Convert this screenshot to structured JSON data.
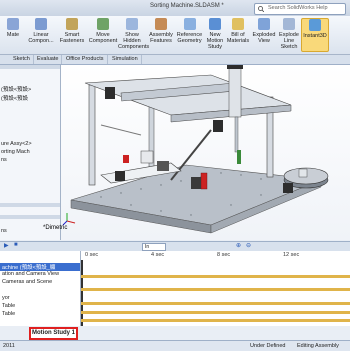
{
  "title_bar": {
    "title": "Sorting Machine.SLDASM *",
    "search_placeholder": "Search SolidWorks Help"
  },
  "ribbon": [
    {
      "label": "Mate",
      "icon": "mate-icon"
    },
    {
      "label": "Linear\nCompon...",
      "icon": "linear-pattern-icon"
    },
    {
      "label": "Smart\nFasteners",
      "icon": "smart-fasteners-icon"
    },
    {
      "label": "Move\nComponent",
      "icon": "move-component-icon"
    },
    {
      "label": "Show\nHidden\nComponents",
      "icon": "show-hidden-icon"
    },
    {
      "label": "Assembly\nFeatures",
      "icon": "assembly-features-icon"
    },
    {
      "label": "Reference\nGeometry",
      "icon": "reference-geometry-icon"
    },
    {
      "label": "New\nMotion\nStudy",
      "icon": "new-motion-study-icon"
    },
    {
      "label": "Bill of\nMaterials",
      "icon": "bill-of-materials-icon"
    },
    {
      "label": "Exploded\nView",
      "icon": "exploded-view-icon"
    },
    {
      "label": "Explode\nLine\nSketch",
      "icon": "explode-line-sketch-icon"
    },
    {
      "label": "Instant3D",
      "icon": "instant3d-icon"
    }
  ],
  "tabs": [
    "Sketch",
    "Evaluate",
    "Office Products",
    "Simulation"
  ],
  "left_panel": {
    "top_lines": [
      "(預設<預設>",
      "(預設<預設",
      "ure Assy<2>",
      "orting Mach",
      "ns"
    ],
    "bottom_line": "ns"
  },
  "viewport": {
    "view_label": "*Dimetric"
  },
  "timeline": {
    "zoom_value": "In",
    "ticks": [
      "0 sec",
      "4 sec",
      "8 sec",
      "12 sec"
    ],
    "tree_rows": [
      "achine (預設<預設_顯",
      "ation and Camera View",
      "Cameras and Scene",
      "",
      "yor",
      "Table",
      "Table"
    ]
  },
  "study_tab": "Motion Study 1",
  "status": {
    "left": "2011",
    "middle": "Under Defined",
    "right": "Editing Assembly"
  },
  "colors": {
    "accent": "#3a6ecf",
    "timeline_bar": "#e0b44a",
    "study_tab_border": "#e02020",
    "active_button": "#f9d97a"
  }
}
